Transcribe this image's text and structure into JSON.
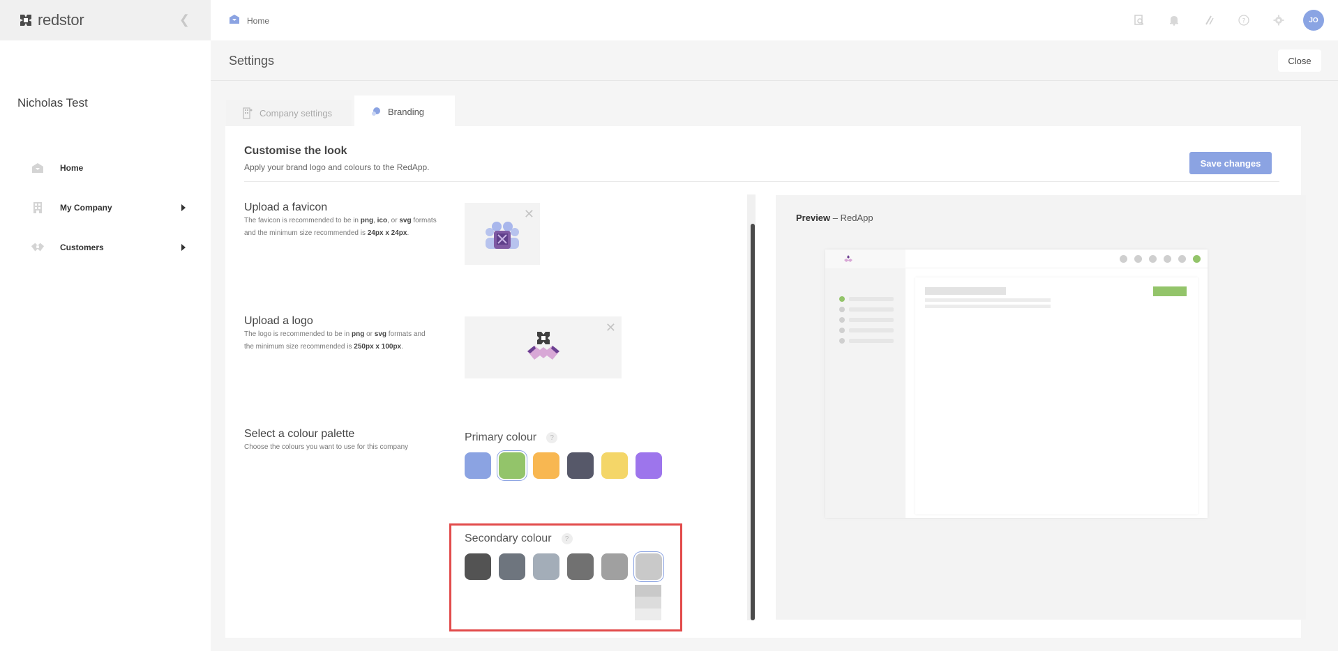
{
  "brand": {
    "name": "redstor",
    "logo_icon": "redstor-logo-icon",
    "collapse_icon": "chevron-left-icon"
  },
  "sidebar": {
    "company_name": "Nicholas Test",
    "items": [
      {
        "label": "Home",
        "icon": "home-icon"
      },
      {
        "label": "My Company",
        "icon": "building-icon",
        "expandable": true
      },
      {
        "label": "Customers",
        "icon": "handshake-icon",
        "expandable": true
      }
    ]
  },
  "topbar": {
    "breadcrumb": "Home",
    "icons": [
      "search-icon",
      "bell-icon",
      "slash-icon",
      "help-icon",
      "gear-icon"
    ],
    "avatar_initials": "JO"
  },
  "settings": {
    "title": "Settings",
    "close_label": "Close"
  },
  "tabs": [
    {
      "label": "Company settings",
      "active": false
    },
    {
      "label": "Branding",
      "active": true
    }
  ],
  "branding": {
    "title": "Customise the look",
    "subtitle": "Apply your brand logo and colours to the RedApp.",
    "save_label": "Save changes",
    "favicon": {
      "heading": "Upload a favicon",
      "desc_1": "The favicon is recommended to be in ",
      "fmt_1": "png",
      "sep_1": ", ",
      "fmt_2": "ico",
      "sep_2": ", or ",
      "fmt_3": "svg",
      "desc_2": " formats and the minimum size recommended is ",
      "size": "24px x 24px",
      "desc_3": "."
    },
    "logo": {
      "heading": "Upload a logo",
      "desc_1": "The logo is recommended to be in ",
      "fmt_1": "png",
      "sep_1": " or ",
      "fmt_2": "svg",
      "desc_2": " formats and the minimum size recommended is ",
      "size": "250px x 100px",
      "desc_3": "."
    },
    "palette": {
      "heading": "Select a colour palette",
      "desc": "Choose the colours you want to use for this company",
      "primary_label": "Primary colour",
      "primary_colors": [
        "#8ba3e2",
        "#93c46a",
        "#f8b751",
        "#565869",
        "#f4d668",
        "#9d75ec"
      ],
      "primary_selected": 1,
      "secondary_label": "Secondary colour",
      "secondary_colors": [
        "#535353",
        "#6e757e",
        "#a3adb8",
        "#717171",
        "#a0a0a0",
        "#c9c9c9"
      ],
      "secondary_selected": 5,
      "secondary_shades": [
        "#c9c9c9",
        "#dcdcdc",
        "#ececec"
      ],
      "help_icon": "question-icon"
    }
  },
  "preview": {
    "label_bold": "Preview",
    "label_rest": " – RedApp",
    "accent": "#93c46a"
  }
}
